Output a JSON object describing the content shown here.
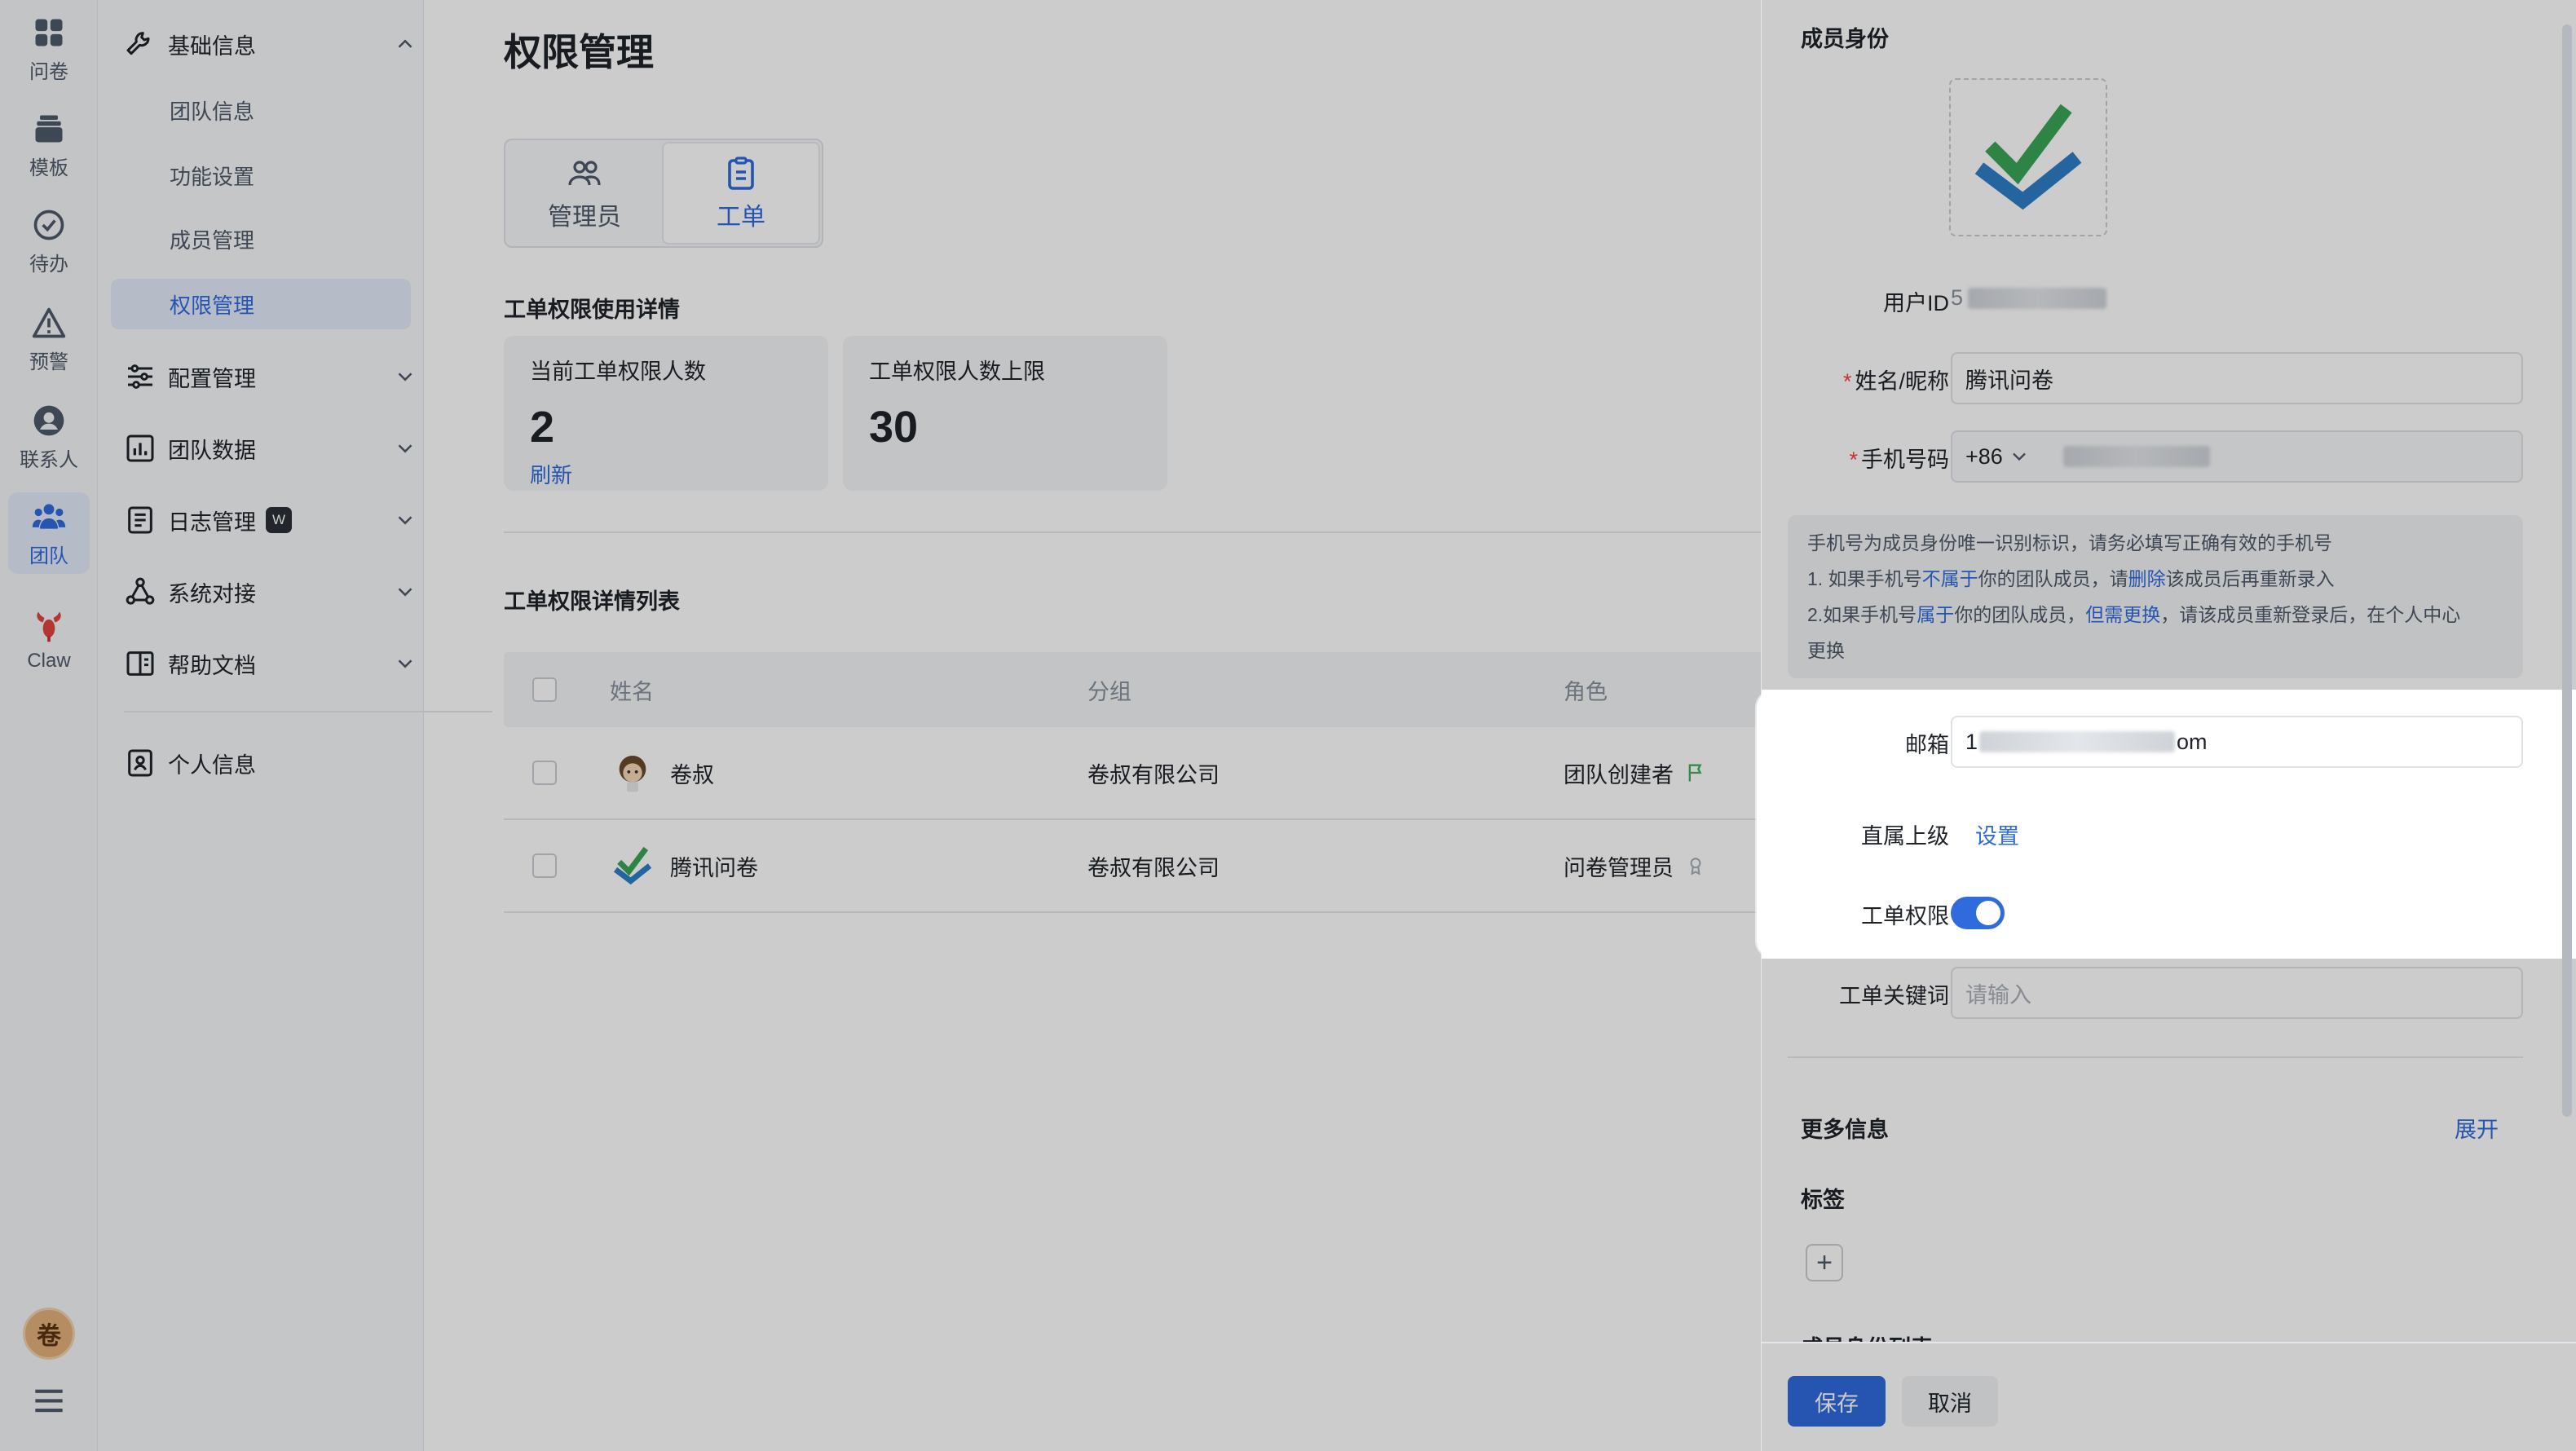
{
  "rail": {
    "items": [
      {
        "label": "问卷",
        "icon": "grid-icon"
      },
      {
        "label": "模板",
        "icon": "stack-icon"
      },
      {
        "label": "待办",
        "icon": "check-circle-icon"
      },
      {
        "label": "预警",
        "icon": "warning-icon"
      },
      {
        "label": "联系人",
        "icon": "contact-icon"
      },
      {
        "label": "团队",
        "icon": "team-icon"
      },
      {
        "label": "Claw",
        "icon": "lobster-icon"
      }
    ],
    "avatar_text": "卷",
    "active": "团队"
  },
  "nav": {
    "basic_info": "基础信息",
    "sub_items": [
      "团队信息",
      "功能设置",
      "成员管理",
      "权限管理"
    ],
    "active_sub": "权限管理",
    "config": "配置管理",
    "team_data": "团队数据",
    "log": "日志管理",
    "log_badge": "W",
    "system": "系统对接",
    "help": "帮助文档",
    "personal": "个人信息"
  },
  "main": {
    "title": "权限管理",
    "tabs": [
      {
        "label": "管理员",
        "icon": "people-icon"
      },
      {
        "label": "工单",
        "icon": "clipboard-icon"
      }
    ],
    "active_tab": "工单",
    "usage_title": "工单权限使用详情",
    "stats": [
      {
        "label": "当前工单权限人数",
        "value": "2",
        "link": "刷新"
      },
      {
        "label": "工单权限人数上限",
        "value": "30"
      }
    ],
    "list_title": "工单权限详情列表",
    "table": {
      "headers": [
        "姓名",
        "分组",
        "角色"
      ],
      "rows": [
        {
          "name": "卷叔",
          "group": "卷叔有限公司",
          "role": "团队创建者"
        },
        {
          "name": "腾讯问卷",
          "group": "卷叔有限公司",
          "role": "问卷管理员"
        }
      ]
    }
  },
  "drawer": {
    "identity_title": "成员身份",
    "user_id_label": "用户ID",
    "user_id_value": "5",
    "name_label": "姓名/昵称",
    "name_value": "腾讯问卷",
    "phone_label": "手机号码",
    "phone_prefix": "+86",
    "note_line1": "手机号为成员身份唯一识别标识，请务必填写正确有效的手机号",
    "note_line2": {
      "a": "1. 如果手机号",
      "b": "不属于",
      "c": "你的团队成员，请",
      "d": "删除",
      "e": "该成员后再重新录入"
    },
    "note_line3": {
      "a": "2.如果手机号",
      "b": "属于",
      "c": "你的团队成员，",
      "d": "但需更换",
      "e": "，请该成员重新登录后，在个人中心"
    },
    "note_line4": "更换",
    "email_label": "邮箱",
    "email_head": "1",
    "email_tail": "om",
    "superior_label": "直属上级",
    "superior_link": "设置",
    "ticket_perm_label": "工单权限",
    "ticket_perm_on": true,
    "keyword_label": "工单关键词",
    "keyword_placeholder": "请输入",
    "more_info": "更多信息",
    "expand": "展开",
    "tags": "标签",
    "identity_list": "成员身份列表",
    "save": "保存",
    "cancel": "取消"
  },
  "colors": {
    "accent": "#2f6bdc",
    "required": "#f53f3f",
    "green_flag": "#3fae5b"
  }
}
